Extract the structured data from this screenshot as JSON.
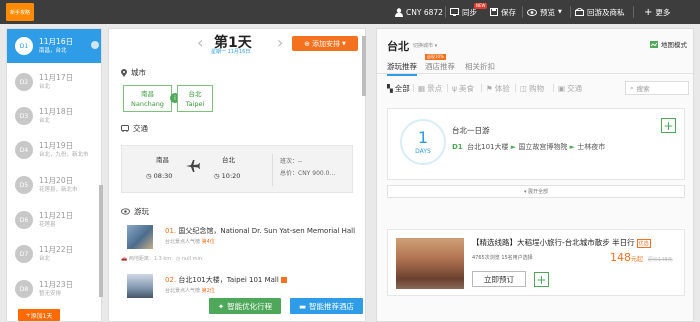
{
  "topbar": {
    "newbie": "新手攻略",
    "currency": "CNY 6872",
    "sync": "同步",
    "sync_badge": "NEW",
    "save": "保存",
    "preview": "预览",
    "back": "回游及商私",
    "more": "更多"
  },
  "days": [
    {
      "badge": "D1",
      "date": "11月16日",
      "cities": "南昌，台北",
      "active": true
    },
    {
      "badge": "D2",
      "date": "11月17日",
      "cities": "台北"
    },
    {
      "badge": "D3",
      "date": "11月18日",
      "cities": "台北"
    },
    {
      "badge": "D4",
      "date": "11月19日",
      "cities": "台北，九份，新北市"
    },
    {
      "badge": "D5",
      "date": "11月20日",
      "cities": "花莲县，新北市"
    },
    {
      "badge": "D6",
      "date": "11月21日",
      "cities": "花莲县"
    },
    {
      "badge": "D7",
      "date": "11月22日",
      "cities": "台北"
    },
    {
      "badge": "D8",
      "date": "11月23日",
      "cities": "暂无安排"
    }
  ],
  "add_day": "添加1天",
  "day_header": {
    "title": "第1天",
    "subtitle": "星期一 11月16日",
    "add_plan": "添加安排"
  },
  "sections": {
    "city": "城市",
    "transport": "交通",
    "play": "游玩"
  },
  "cities": [
    {
      "cn": "南昌",
      "en": "Nanchang"
    },
    {
      "cn": "台北",
      "en": "Taipei"
    }
  ],
  "transport": {
    "from": "南昌",
    "to": "台北",
    "depart": "08:30",
    "arrive": "10:20",
    "flight": "班次：--",
    "price": "总价：CNY 900.0..."
  },
  "attractions": [
    {
      "num": "01.",
      "name": "国父纪念馆，National Dr. Sun Yat-sen Memorial Hall",
      "pop_label": "台北景点人气榜",
      "pop_rank": "第4位"
    },
    {
      "num": "02.",
      "name": "台北101大楼，Taipei 101 Mall",
      "pop_label": "台北景点人气榜",
      "pop_rank": "第2位"
    }
  ],
  "distance": {
    "label": "两地距离：1.3 km",
    "time": "null min"
  },
  "smart_route": "智能优化行程",
  "smart_hotel": "智能推荐酒店",
  "right": {
    "city": "台北",
    "switch": "切换城市",
    "map_mode": "地图模式",
    "tabs": [
      "游玩推荐",
      "酒店推荐",
      "相关折扣"
    ],
    "hot_label": "返现10%",
    "categories": [
      "全部",
      "景点",
      "美食",
      "体验",
      "购物",
      "交通"
    ],
    "search_placeholder": "搜索"
  },
  "route_card": {
    "day_num": "1",
    "day_label": "DAYS",
    "title": "台北一日游",
    "dl": "D1",
    "stops": [
      "台北101大楼",
      "国立故宫博物院",
      "士林夜市"
    ]
  },
  "expand_all": "展开全部",
  "tour_card": {
    "title": "【精选线路】大稻埕小旅行-台北城市散步 半日行",
    "tag": "优选",
    "info": "4765次浏览    15名用户选择",
    "price": "148",
    "price_unit": "元起",
    "old_price": "原价148元",
    "book": "立即预订"
  },
  "colors": {
    "accent": "#2e9ce7",
    "orange": "#f4711f",
    "green": "#4fa85a",
    "topbar": "#3d3d3d"
  }
}
